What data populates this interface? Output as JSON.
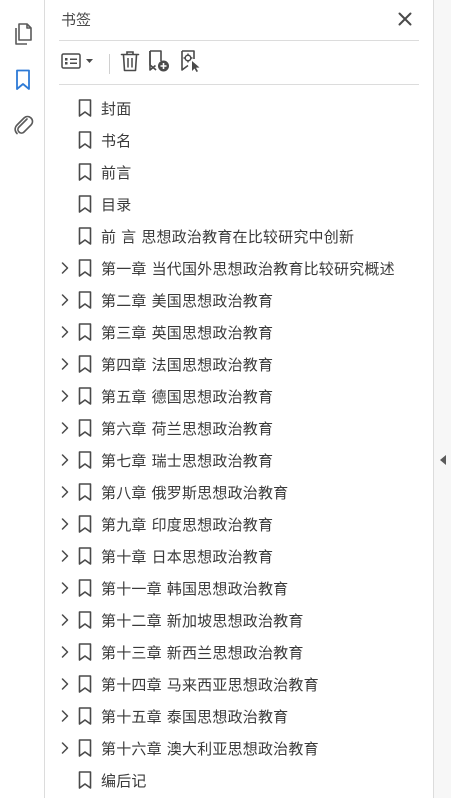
{
  "rail": {
    "icons": [
      "pages-icon",
      "bookmark-icon",
      "attachment-icon"
    ],
    "accent": "#2d7ad6"
  },
  "panel": {
    "title": "书签",
    "toolbar_icons": [
      "options-list-icon",
      "delete-icon",
      "new-bookmark-icon",
      "new-bookmark-from-structure-icon"
    ]
  },
  "bookmarks": [
    {
      "label": "封面",
      "expandable": false
    },
    {
      "label": "书名",
      "expandable": false
    },
    {
      "label": "前言",
      "expandable": false
    },
    {
      "label": "目录",
      "expandable": false
    },
    {
      "label": "前  言  思想政治教育在比较研究中创新",
      "expandable": false
    },
    {
      "label": "第一章  当代国外思想政治教育比较研究概述",
      "expandable": true
    },
    {
      "label": "第二章  美国思想政治教育",
      "expandable": true
    },
    {
      "label": "第三章  英国思想政治教育",
      "expandable": true
    },
    {
      "label": "第四章  法国思想政治教育",
      "expandable": true
    },
    {
      "label": "第五章  德国思想政治教育",
      "expandable": true
    },
    {
      "label": "第六章  荷兰思想政治教育",
      "expandable": true
    },
    {
      "label": "第七章  瑞士思想政治教育",
      "expandable": true
    },
    {
      "label": "第八章  俄罗斯思想政治教育",
      "expandable": true
    },
    {
      "label": "第九章  印度思想政治教育",
      "expandable": true
    },
    {
      "label": "第十章  日本思想政治教育",
      "expandable": true
    },
    {
      "label": "第十一章  韩国思想政治教育",
      "expandable": true
    },
    {
      "label": "第十二章  新加坡思想政治教育",
      "expandable": true
    },
    {
      "label": "第十三章  新西兰思想政治教育",
      "expandable": true
    },
    {
      "label": "第十四章  马来西亚思想政治教育",
      "expandable": true
    },
    {
      "label": "第十五章  泰国思想政治教育",
      "expandable": true
    },
    {
      "label": "第十六章  澳大利亚思想政治教育",
      "expandable": true
    },
    {
      "label": "编后记",
      "expandable": false
    }
  ]
}
